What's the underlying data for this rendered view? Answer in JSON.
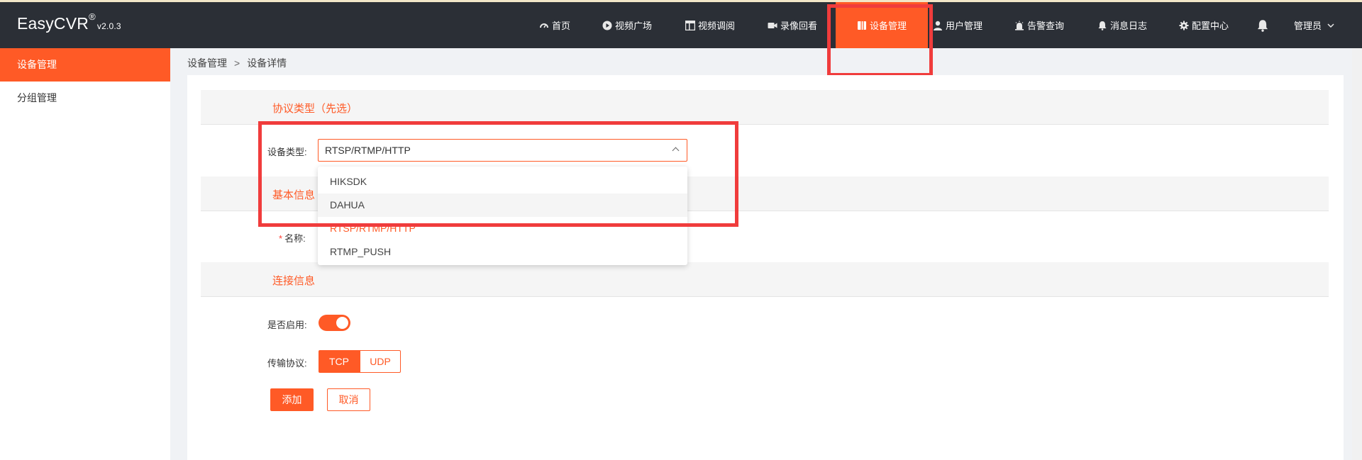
{
  "app": {
    "name": "EasyCVR",
    "registered": "®",
    "version": "v2.0.3"
  },
  "nav": {
    "items": [
      {
        "label": "首页",
        "icon": "dashboard-icon"
      },
      {
        "label": "视频广场",
        "icon": "play-circle-icon"
      },
      {
        "label": "视频调阅",
        "icon": "layout-icon"
      },
      {
        "label": "录像回看",
        "icon": "video-camera-icon"
      },
      {
        "label": "设备管理",
        "icon": "device-icon",
        "active": true
      },
      {
        "label": "用户管理",
        "icon": "user-icon"
      },
      {
        "label": "告警查询",
        "icon": "alarm-icon"
      },
      {
        "label": "消息日志",
        "icon": "bell-icon"
      },
      {
        "label": "配置中心",
        "icon": "gear-icon"
      }
    ],
    "notification_icon": "bell-icon",
    "user": "管理员",
    "user_caret_icon": "chevron-down-icon"
  },
  "sidebar": {
    "items": [
      {
        "label": "设备管理",
        "active": true
      },
      {
        "label": "分组管理"
      }
    ]
  },
  "breadcrumb": {
    "root": "设备管理",
    "separator": ">",
    "current": "设备详情"
  },
  "form": {
    "sections": {
      "protocol": "协议类型（先选）",
      "basic": "基本信息",
      "connection": "连接信息"
    },
    "device_type": {
      "label": "设备类型:",
      "value": "RTSP/RTMP/HTTP",
      "options": [
        "HIKSDK",
        "DAHUA",
        "RTSP/RTMP/HTTP",
        "RTMP_PUSH"
      ],
      "hovered": "DAHUA",
      "selected": "RTSP/RTMP/HTTP"
    },
    "name": {
      "required_mark": "*",
      "label": "名称:"
    },
    "enabled": {
      "label": "是否启用:",
      "on": true
    },
    "transport": {
      "label": "传输协议:",
      "options": [
        "TCP",
        "UDP"
      ],
      "selected": "TCP"
    },
    "buttons": {
      "add": "添加",
      "cancel": "取消"
    }
  },
  "colors": {
    "accent": "#ff5a26",
    "topbar": "#2b2f36",
    "annotation": "#f03c3c"
  }
}
